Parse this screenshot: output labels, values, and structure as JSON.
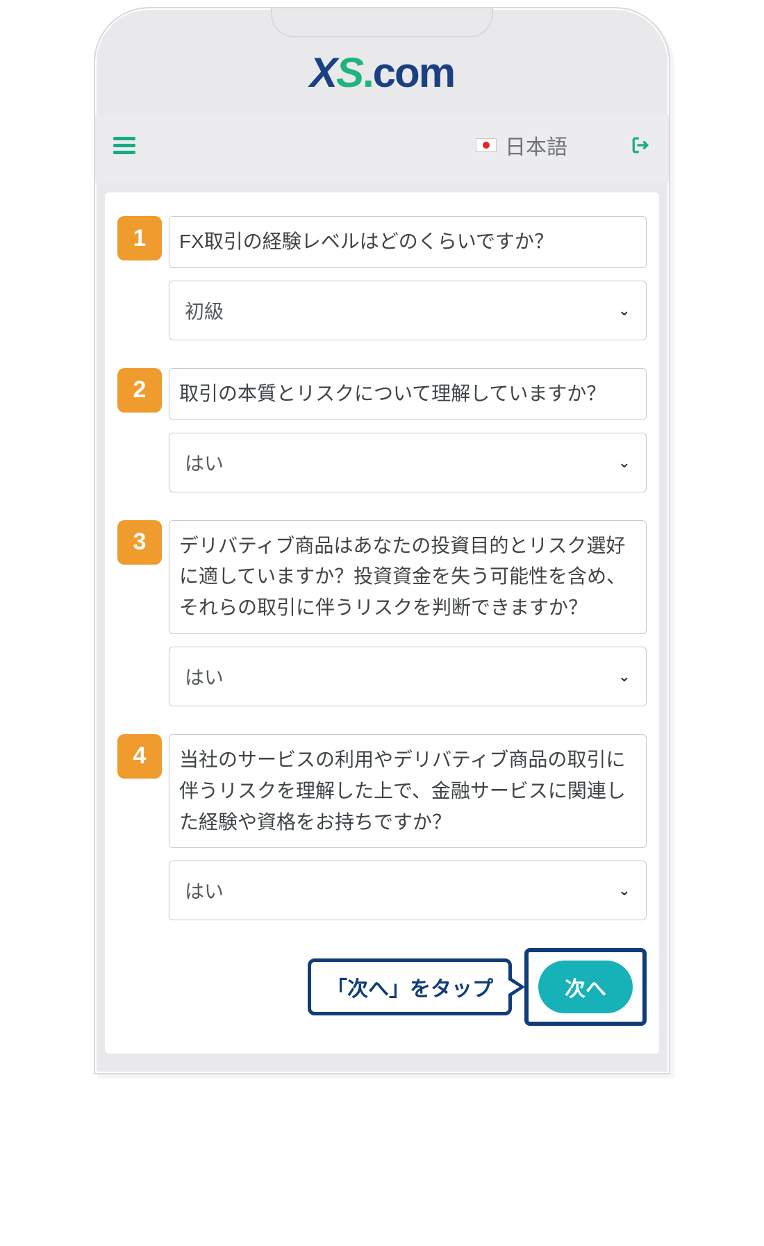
{
  "logo": {
    "xs_x": "X",
    "xs_s": "S",
    "dot": ".",
    "com": "com"
  },
  "header": {
    "language_label": "日本語"
  },
  "questions": [
    {
      "n": "1",
      "text": "FX取引の経験レベルはどのくらいですか？",
      "value": "初級"
    },
    {
      "n": "2",
      "text": "取引の本質とリスクについて理解していますか？",
      "value": "はい"
    },
    {
      "n": "3",
      "text": "デリバティブ商品はあなたの投資目的とリスク選好に適していますか？投資資金を失う可能性を含め、それらの取引に伴うリスクを判断できますか？",
      "value": "はい"
    },
    {
      "n": "4",
      "text": "当社のサービスの利用やデリバティブ商品の取引に伴うリスクを理解した上で、金融サービスに関連した経験や資格をお持ちですか？",
      "value": "はい"
    }
  ],
  "callout": "「次へ」をタップ",
  "next_button": "次へ"
}
